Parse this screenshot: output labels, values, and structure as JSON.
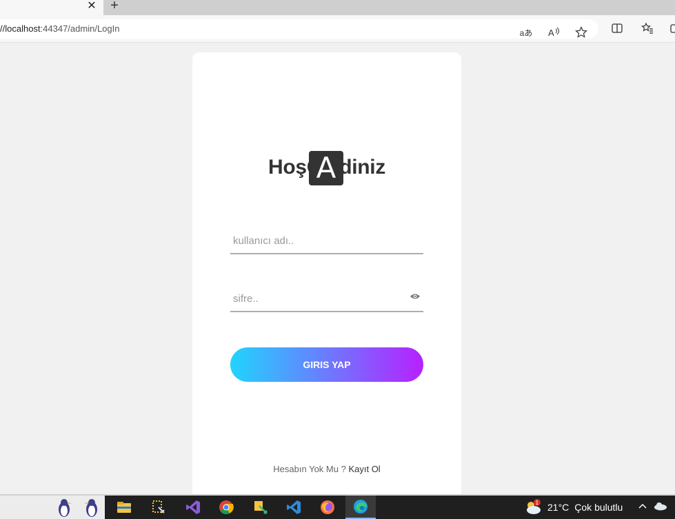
{
  "browser": {
    "tab_close": "✕",
    "tab_new": "+",
    "url_host": "//localhost",
    "url_rest": ":44347/admin/LogIn",
    "read_aloud_label": "aあ"
  },
  "login": {
    "title": "HoşGeldiniz",
    "logo_letter": "A",
    "username_placeholder": "kullanıcı adı..",
    "password_placeholder": "sifre..",
    "submit_label": "GIRIS YAP",
    "signup_prompt": "Hesabın Yok Mu ?",
    "signup_link": "Kayıt Ol",
    "button_gradient": [
      "#21d4fd",
      "#b721ff"
    ]
  },
  "taskbar": {
    "weather_badge": "1",
    "temperature": "21°C",
    "weather_desc": "Çok bulutlu",
    "apps": [
      "file-explorer-icon",
      "visual-studio-installer-icon",
      "visual-studio-icon",
      "chrome-icon",
      "tool-icon",
      "vscode-icon",
      "firefox-icon",
      "edge-icon"
    ]
  }
}
